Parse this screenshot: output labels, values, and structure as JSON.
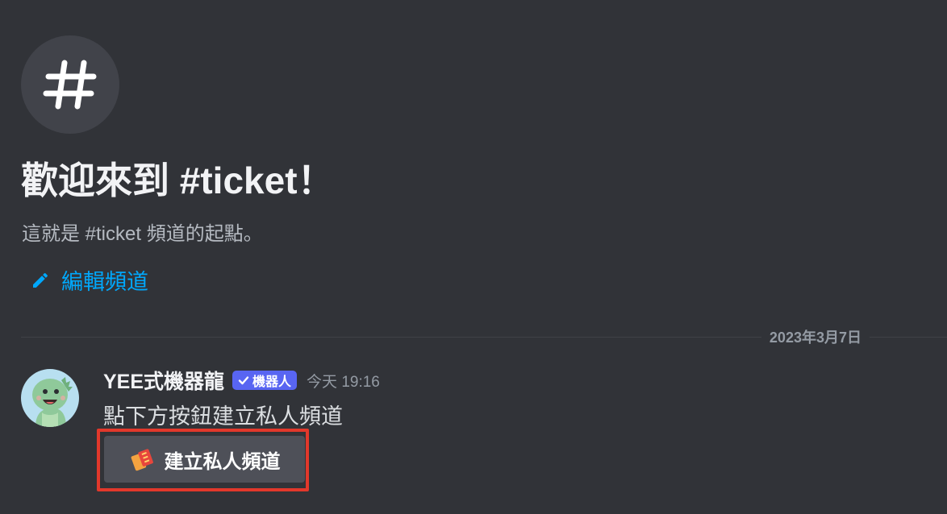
{
  "welcome": {
    "title": "歡迎來到 #ticket！",
    "subtitle": "這就是 #ticket 頻道的起點。",
    "edit_channel_label": "編輯頻道"
  },
  "divider": {
    "date": "2023年3月7日"
  },
  "message": {
    "username": "YEE式機器龍",
    "bot_badge": "機器人",
    "timestamp": "今天 19:16",
    "text": "點下方按鈕建立私人頻道",
    "button_label": "建立私人頻道"
  },
  "icons": {
    "channel": "hashtag-icon",
    "edit": "pencil-icon",
    "verified": "checkmark-icon",
    "button": "ticket-icon"
  },
  "colors": {
    "background": "#313338",
    "link": "#00a8fc",
    "bot_badge": "#5865f2",
    "highlight": "#e2382b",
    "button_bg": "#4e5058"
  }
}
